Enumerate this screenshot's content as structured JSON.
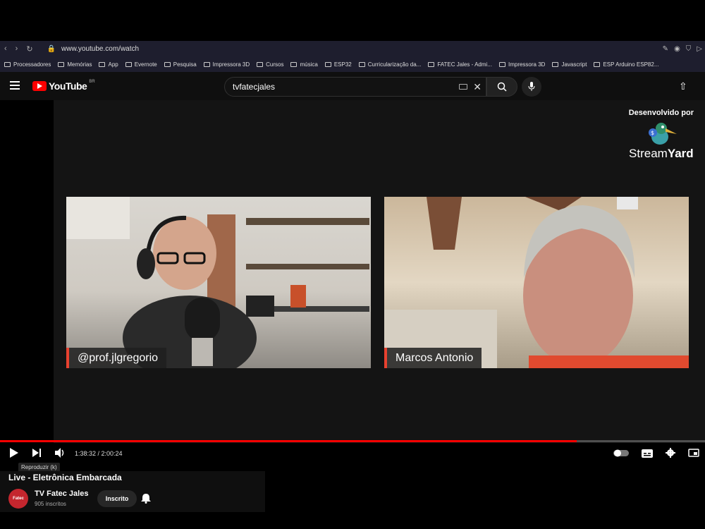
{
  "browser": {
    "url": "www.youtube.com/watch",
    "bookmarks": [
      "Processadores",
      "Memórias",
      "App",
      "Evernote",
      "Pesquisa",
      "Impressora 3D",
      "Cursos",
      "música",
      "ESP32",
      "Curricularização da...",
      "FATEC Jales - Admi...",
      "Impressora 3D",
      "Javascript",
      "ESP Arduino ESP82..."
    ]
  },
  "youtube": {
    "logo_text": "YouTube",
    "country": "BR",
    "search_value": "tvfatecjales"
  },
  "stream": {
    "developed_by": "Desenvolvido por",
    "brand_light": "Stream",
    "brand_bold": "Yard",
    "participants": [
      "@prof.jlgregorio",
      "Marcos Antonio"
    ]
  },
  "player": {
    "time": "1:38:32 / 2:00:24",
    "progress_fraction": 0.818,
    "tooltip": "Reproduzir (k)"
  },
  "video": {
    "title": "Live - Eletrônica Embarcada",
    "channel": "TV Fatec Jales",
    "subscribers": "905 inscritos",
    "subscribe_label": "Inscrito",
    "avatar_text": "Fatec"
  },
  "colors": {
    "accent": "#ff0000",
    "nameplate": "#e8412f"
  }
}
